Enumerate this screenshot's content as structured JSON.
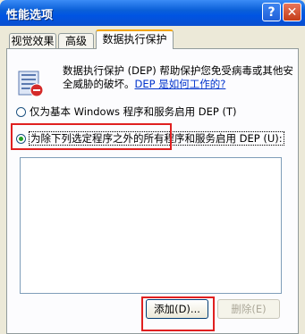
{
  "window": {
    "title": "性能选项",
    "help_label": "?",
    "close_label": "✕"
  },
  "tabs": [
    {
      "label": "视觉效果"
    },
    {
      "label": "高级"
    },
    {
      "label": "数据执行保护"
    }
  ],
  "content": {
    "description": "数据执行保护 (DEP) 帮助保护您免受病毒或其他安全威胁的破坏。",
    "link": "DEP 是如何工作的?",
    "option_essential": "仅为基本 Windows 程序和服务启用 DEP (T)",
    "option_all_except": "为除下列选定程序之外的所有程序和服务启用 DEP (U):",
    "selected_option": "option_all_except"
  },
  "buttons": {
    "add": "添加(D)...",
    "remove": "删除(E)"
  },
  "accent": {
    "highlight": "#e02020",
    "title_bar": "#0054e3"
  }
}
